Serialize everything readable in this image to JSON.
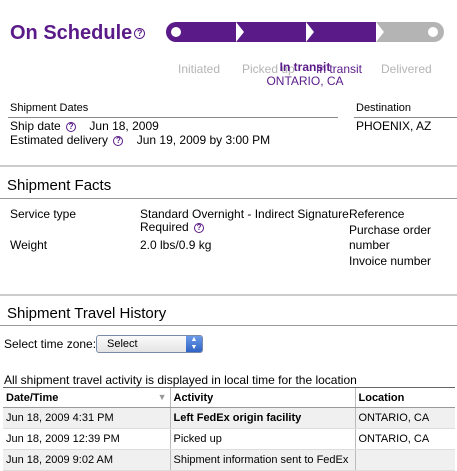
{
  "status": {
    "title": "On Schedule",
    "help_icon": "?",
    "stages": [
      "Initiated",
      "Picked up",
      "In transit",
      "Delivered"
    ],
    "current_stage": "In transit",
    "current_status": "In transit",
    "current_location": "ONTARIO, CA"
  },
  "dates": {
    "section_label": "Shipment Dates",
    "ship_date_label": "Ship date",
    "ship_date": "Jun 18, 2009",
    "delivery_label": "Estimated delivery",
    "delivery_value": "Jun 19, 2009 by 3:00 PM",
    "destination_label": "Destination",
    "destination": "PHOENIX, AZ"
  },
  "facts": {
    "title": "Shipment Facts",
    "service_label": "Service type",
    "service_value_line1": "Standard Overnight - Indirect Signature",
    "service_value_line2": "Required",
    "weight_label": "Weight",
    "weight_value": "2.0 lbs/0.9 kg",
    "reference_label": "Reference",
    "po_label_line1": "Purchase order",
    "po_label_line2": "number",
    "invoice_label": "Invoice number"
  },
  "history": {
    "title": "Shipment Travel History",
    "timezone_label": "Select time zone:",
    "timezone_value": "Select",
    "note": "All shipment travel activity is displayed in local time for the location",
    "columns": [
      "Date/Time",
      "Activity",
      "Location"
    ],
    "rows": [
      {
        "datetime": "Jun 18, 2009 4:31 PM",
        "activity": "Left FedEx origin facility",
        "location": "ONTARIO, CA",
        "bold": true
      },
      {
        "datetime": "Jun 18, 2009 12:39 PM",
        "activity": "Picked up",
        "location": "ONTARIO, CA",
        "bold": false
      },
      {
        "datetime": "Jun 18, 2009 9:02 AM",
        "activity": "Shipment information sent to FedEx",
        "location": "",
        "bold": false
      }
    ]
  },
  "colors": {
    "accent": "#5a1b89",
    "inactive": "#b4b4b4"
  }
}
